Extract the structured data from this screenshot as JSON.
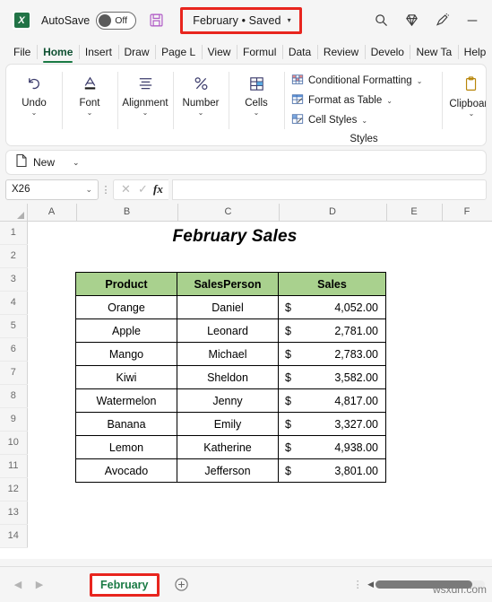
{
  "titlebar": {
    "app_icon": "excel-logo-icon",
    "app_icon_letter": "X",
    "autosave_label": "AutoSave",
    "autosave_state": "Off",
    "save_icon": "save-floppy-icon",
    "document_title": "February • Saved",
    "title_dropdown_caret": "▾",
    "highlight_color": "#e8251e",
    "right_icons": [
      {
        "name": "search-icon",
        "glyph": "search"
      },
      {
        "name": "diamond-icon",
        "glyph": "diamond"
      },
      {
        "name": "highlighter-pen-icon",
        "glyph": "pen"
      },
      {
        "name": "minimize-icon",
        "glyph": "minimize"
      }
    ]
  },
  "ribbon_tabs": [
    {
      "label": "File",
      "active": false
    },
    {
      "label": "Home",
      "active": true
    },
    {
      "label": "Insert",
      "active": false
    },
    {
      "label": "Draw",
      "active": false
    },
    {
      "label": "Page L",
      "active": false
    },
    {
      "label": "View",
      "active": false
    },
    {
      "label": "Formul",
      "active": false
    },
    {
      "label": "Data",
      "active": false
    },
    {
      "label": "Review",
      "active": false
    },
    {
      "label": "Develo",
      "active": false
    },
    {
      "label": "New Ta",
      "active": false
    },
    {
      "label": "Help",
      "active": false
    }
  ],
  "ribbon": {
    "groups": [
      {
        "label": "Undo",
        "icon": "undo-arrow-icon",
        "chevron": "⌄"
      },
      {
        "label": "Font",
        "icon": "font-letter-a-icon",
        "chevron": "⌄"
      },
      {
        "label": "Alignment",
        "icon": "alignment-lines-icon",
        "chevron": "⌄"
      },
      {
        "label": "Number",
        "icon": "percent-icon",
        "chevron": "⌄"
      },
      {
        "label": "Cells",
        "icon": "cells-table-icon",
        "chevron": "⌄"
      }
    ],
    "styles": {
      "title": "Styles",
      "items": [
        {
          "label": "Conditional Formatting",
          "icon": "conditional-formatting-icon",
          "chevron": "⌄"
        },
        {
          "label": "Format as Table",
          "icon": "format-as-table-icon",
          "chevron": "⌄"
        },
        {
          "label": "Cell Styles",
          "icon": "cell-styles-icon",
          "chevron": "⌄"
        }
      ]
    },
    "clipboard": {
      "label": "Clipboard",
      "icon": "clipboard-icon",
      "chevron": "⌄"
    }
  },
  "quick_bar": {
    "new_label": "New",
    "new_icon": "new-document-icon",
    "chevron": "⌄"
  },
  "formula_bar": {
    "name_box_value": "X26",
    "name_box_caret": "⌄",
    "cancel_icon": "✕",
    "enter_icon": "✓",
    "fx_label": "fx",
    "formula_value": "",
    "formula_placeholder": ""
  },
  "grid": {
    "columns": [
      "A",
      "B",
      "C",
      "D",
      "E",
      "F"
    ],
    "rows": [
      "1",
      "2",
      "3",
      "4",
      "5",
      "6",
      "7",
      "8",
      "9",
      "10",
      "11",
      "12",
      "13",
      "14"
    ]
  },
  "sheet_content": {
    "title": "February Sales",
    "header_fill": "#a9d18e",
    "table_headers": [
      "Product",
      "SalesPerson",
      "Sales"
    ],
    "rows": [
      {
        "product": "Orange",
        "person": "Daniel",
        "currency": "$",
        "amount": "4,052.00"
      },
      {
        "product": "Apple",
        "person": "Leonard",
        "currency": "$",
        "amount": "2,781.00"
      },
      {
        "product": "Mango",
        "person": "Michael",
        "currency": "$",
        "amount": "2,783.00"
      },
      {
        "product": "Kiwi",
        "person": "Sheldon",
        "currency": "$",
        "amount": "3,582.00"
      },
      {
        "product": "Watermelon",
        "person": "Jenny",
        "currency": "$",
        "amount": "4,817.00"
      },
      {
        "product": "Banana",
        "person": "Emily",
        "currency": "$",
        "amount": "3,327.00"
      },
      {
        "product": "Lemon",
        "person": "Katherine",
        "currency": "$",
        "amount": "4,938.00"
      },
      {
        "product": "Avocado",
        "person": "Jefferson",
        "currency": "$",
        "amount": "3,801.00"
      }
    ]
  },
  "sheet_bar": {
    "prev_arrow": "◀",
    "next_arrow": "▶",
    "active_sheet": "February",
    "add_sheet_icon": "plus-circle-icon",
    "overflow_dots": "⋮",
    "scroll_left_arrow": "◀"
  },
  "watermark": "wsxdn.com"
}
